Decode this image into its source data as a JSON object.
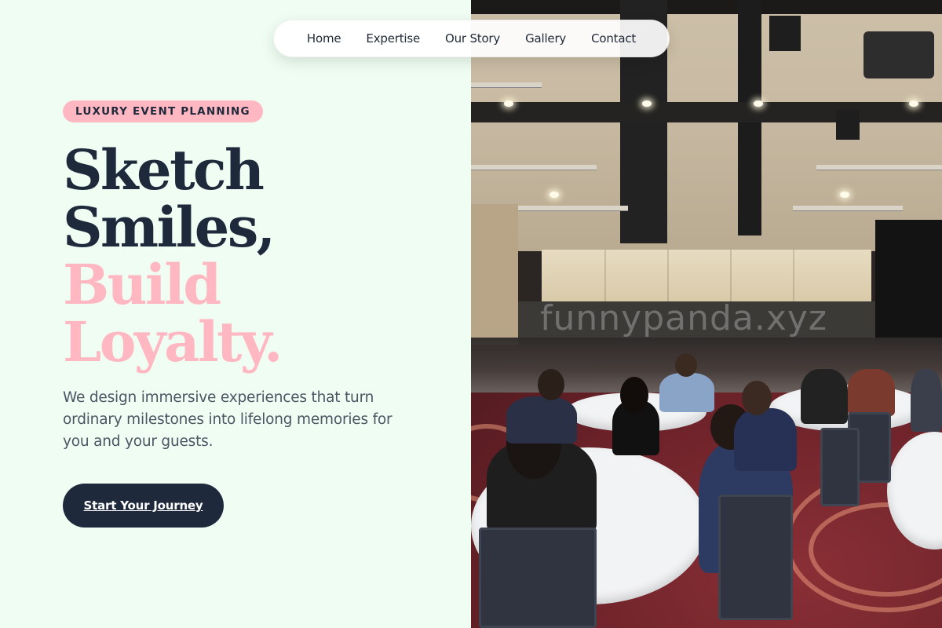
{
  "nav": {
    "items": [
      "Home",
      "Expertise",
      "Our Story",
      "Gallery",
      "Contact"
    ]
  },
  "hero": {
    "badge": "LUXURY EVENT PLANNING",
    "headline": {
      "line1": "Sketch",
      "line2": "Smiles,",
      "line3": "Build",
      "line4": "Loyalty."
    },
    "description": "We design immersive experiences that turn ordinary milestones into lifelong memories for you and your guests.",
    "cta_label": "Start Your Journey"
  },
  "image": {
    "watermark": "funnypanda.xyz"
  },
  "colors": {
    "background": "#effdf3",
    "accent_pink": "#ffb8c2",
    "navy": "#1e2a3c",
    "text_gray": "#4b5563"
  }
}
